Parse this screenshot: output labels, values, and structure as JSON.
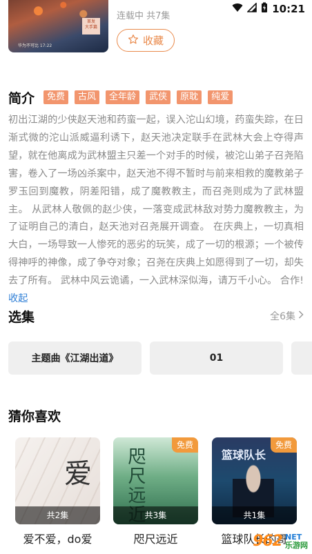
{
  "status_bar": {
    "time": "10:21",
    "icons": [
      "wifi-icon",
      "signal-icon",
      "battery-icon"
    ]
  },
  "header": {
    "update_status": "连载中  共7集",
    "favorite_label": "收藏",
    "cover_badge": "首发\n大手篇",
    "cover_caption": "华为不可比 17:22"
  },
  "intro": {
    "title": "简介",
    "tags": [
      "免费",
      "古风",
      "全年龄",
      "武侠",
      "原耽",
      "纯爱"
    ],
    "text": "初出江湖的少侠赵天池和药蛮一起，误入沱山幻境，药蛮失踪，在日渐式微的沱山派威逼利诱下，赵天池决定联手在武林大会上夺得声望，就在他离成为武林盟主只差一个对手的时候，被沱山弟子召尧陷害，卷入了一场凶杀案中，赵天池不得不暂时与前来相救的魔教弟子罗玉回到魔教，阴差阳错，成了魔教教主，而召尧则成为了武林盟主。 从武林人敬佩的赵少侠，一落变成武林敌对势力魔教教主，为了证明自己的清白，赵天池对召尧展开调查。 在庆典上，一切真相大白，一场导致一人惨死的恶劣的玩笑，成了一切的根源；一个被传得神呼的神像，成了争夺对象；召尧在庆典上如愿得到了一切，却失去了所有。 武林中风云诡谲，一入武林深似海，请万千小心。 合作!",
    "collapse_label": "收起"
  },
  "episodes": {
    "title": "选集",
    "all_label": "全6集",
    "items": [
      "主题曲《江湖出道》",
      "01"
    ]
  },
  "guess": {
    "title": "猜你喜欢",
    "items": [
      {
        "title": "爱不爱，do爱",
        "count": "共2集",
        "free": "",
        "cover_text": "爱"
      },
      {
        "title": "咫尺远近",
        "count": "共3集",
        "free": "免费",
        "cover_text": "咫尺远近"
      },
      {
        "title": "篮球队长的哥",
        "count": "共1集",
        "free": "免费",
        "cover_text": "篮球队长"
      }
    ]
  },
  "watermark": {
    "brand": "962",
    "net": "NET",
    "sub": "乐游网"
  },
  "colors": {
    "accent": "#e9894a",
    "tag": "#f2956d",
    "link": "#2f7fd6",
    "free_badge": "#f29a3c"
  }
}
